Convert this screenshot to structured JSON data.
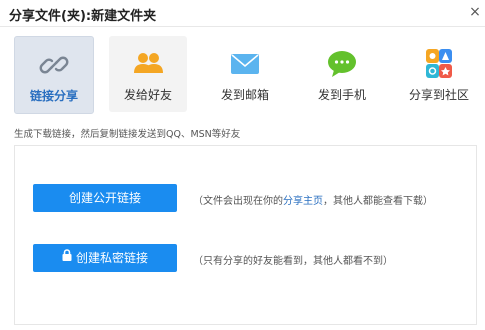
{
  "dialog": {
    "title": "分享文件(夹):新建文件夹",
    "close_glyph": "×"
  },
  "tabs": [
    {
      "label": "链接分享",
      "icon": "link-icon",
      "selected": true
    },
    {
      "label": "发给好友",
      "icon": "friends-icon",
      "selected": false
    },
    {
      "label": "发到邮箱",
      "icon": "mail-icon",
      "selected": false
    },
    {
      "label": "发到手机",
      "icon": "chat-icon",
      "selected": false
    },
    {
      "label": "分享到社区",
      "icon": "community-icon",
      "selected": false
    }
  ],
  "hint": "生成下载链接，然后复制链接发送到QQ、MSN等好友",
  "public_link": {
    "button_label": "创建公开链接",
    "desc_prefix": "（文件会出现在你的",
    "desc_link": "分享主页",
    "desc_suffix": "，其他人都能查看下载）"
  },
  "private_link": {
    "button_label": "创建私密链接",
    "icon": "lock-icon",
    "desc": "（只有分享的好友能看到，其他人都看不到）"
  },
  "colors": {
    "accent": "#1a8cf0",
    "link": "#2a6fc0",
    "selected_tab_bg": "#dfe5ee"
  }
}
